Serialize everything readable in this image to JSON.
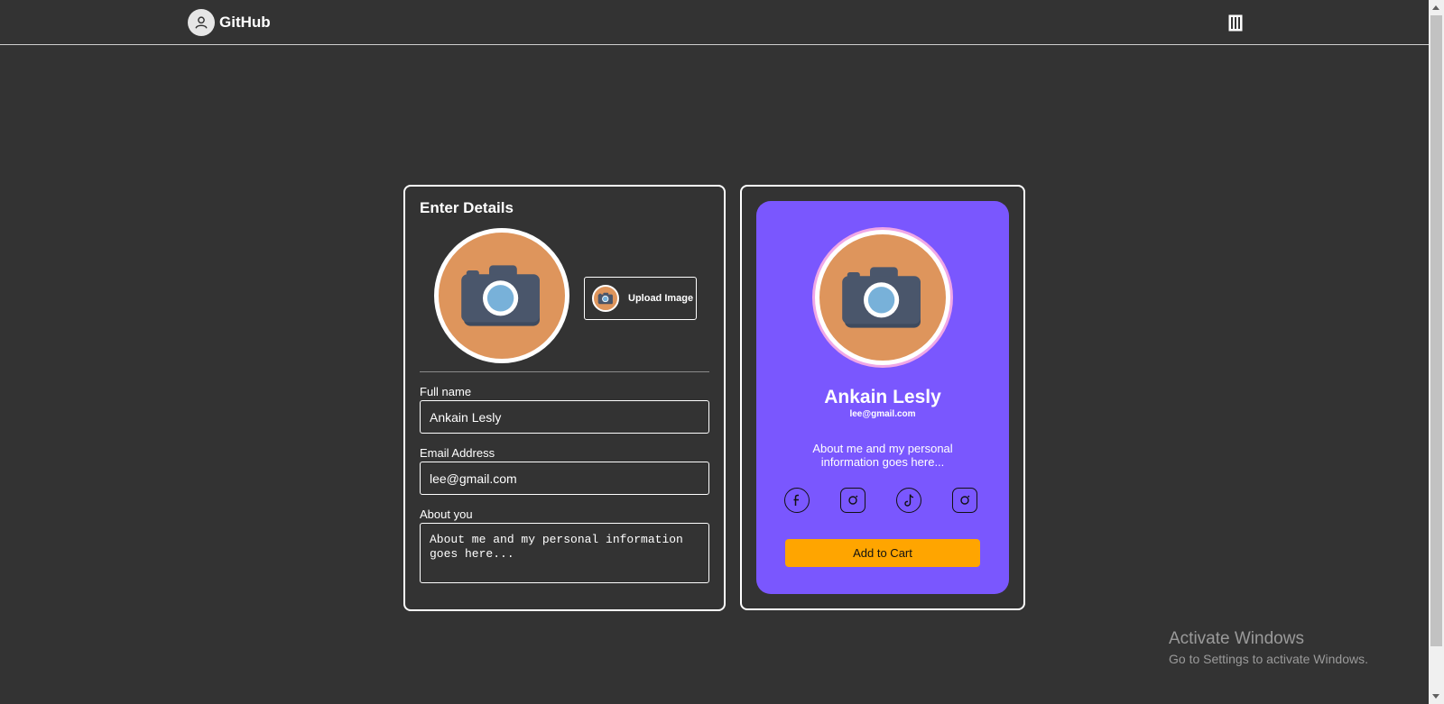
{
  "header": {
    "brand": "GitHub",
    "avatar_icon": "user-icon",
    "menu_icon": "columns-icon"
  },
  "form": {
    "title": "Enter Details",
    "photo_icon": "camera-icon",
    "upload_label": "Upload Image",
    "fields": {
      "full_name": {
        "label": "Full name",
        "value": "Ankain Lesly"
      },
      "email": {
        "label": "Email Address",
        "value": "lee@gmail.com"
      },
      "about": {
        "label": "About you",
        "value": "About me and my personal information goes here..."
      }
    }
  },
  "card": {
    "name": "Ankain Lesly",
    "email": "lee@gmail.com",
    "about": "About me and my personal information goes here...",
    "socials": [
      "facebook-icon",
      "instagram-icon",
      "tiktok-icon",
      "instagram-icon"
    ],
    "cart_label": "Add to Cart",
    "background": "#7a57fe",
    "button_color": "#ffa500"
  },
  "watermark": {
    "title": "Activate Windows",
    "subtitle": "Go to Settings to activate Windows."
  }
}
